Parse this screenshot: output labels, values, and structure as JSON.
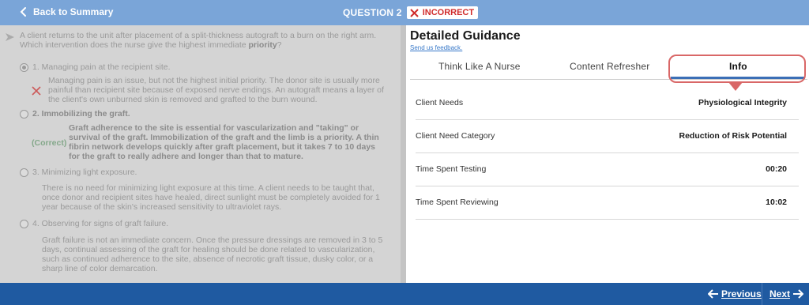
{
  "header": {
    "back_label": "Back to Summary",
    "question_label": "QUESTION 2",
    "status_label": "INCORRECT",
    "status_color": "#d02b2b"
  },
  "question": {
    "stem_text": "A client returns to the unit after placement of a split-thickness autograft to a burn on the right arm. Which intervention does the nurse give the highest immediate ",
    "stem_emphasis": "priority",
    "stem_end": "?",
    "options": [
      {
        "label": "1. Managing pain at the recipient site.",
        "rationale": "Managing pain is an issue, but not the highest initial priority. The donor site is usually more painful than recipient site because of exposed nerve endings. An autograft means a layer of the client's own unburned skin is removed and grafted to the burn wound.",
        "marker": "incorrect"
      },
      {
        "label": "2. Immobilizing the graft.",
        "rationale": "Graft adherence to the site is essential for vascularization and \"taking\" or survival of the graft. Immobilization of the graft and the limb is a priority. A thin fibrin network develops quickly after graft placement, but it takes 7 to 10 days for the graft to really adhere and longer than that to mature.",
        "marker": "(Correct)"
      },
      {
        "label": "3. Minimizing light exposure.",
        "rationale": "There is no need for minimizing light exposure at this time. A client needs to be taught that, once donor and recipient sites have healed, direct sunlight must be completely avoided for 1 year because of the skin's increased sensitivity to ultraviolet rays."
      },
      {
        "label": "4. Observing for signs of graft failure.",
        "rationale": "Graft failure is not an immediate concern. Once the pressure dressings are removed in 3 to 5 days, continual assessing of the graft for healing should be done related to vascularization, such as continued adherence to the site, absence of necrotic graft tissue, dusky color, or a sharp line of color demarcation."
      }
    ]
  },
  "guidance": {
    "title": "Detailed Guidance",
    "feedback_link": "Send us feedback.",
    "tabs": [
      "Think Like A Nurse",
      "Content Refresher",
      "Info"
    ],
    "active_tab": "Info",
    "rows": [
      {
        "key": "Client Needs",
        "value": "Physiological Integrity"
      },
      {
        "key": "Client Need Category",
        "value": "Reduction of Risk Potential"
      },
      {
        "key": "Time Spent Testing",
        "value": "00:20"
      },
      {
        "key": "Time Spent Reviewing",
        "value": "10:02"
      }
    ]
  },
  "footer": {
    "previous_label": "Previous",
    "next_label": "Next"
  },
  "colors": {
    "topbar": "#7aa5d8",
    "bottombar": "#1f5aa1",
    "active_tab_underline": "#3b6fb6",
    "callout": "#d96767"
  }
}
